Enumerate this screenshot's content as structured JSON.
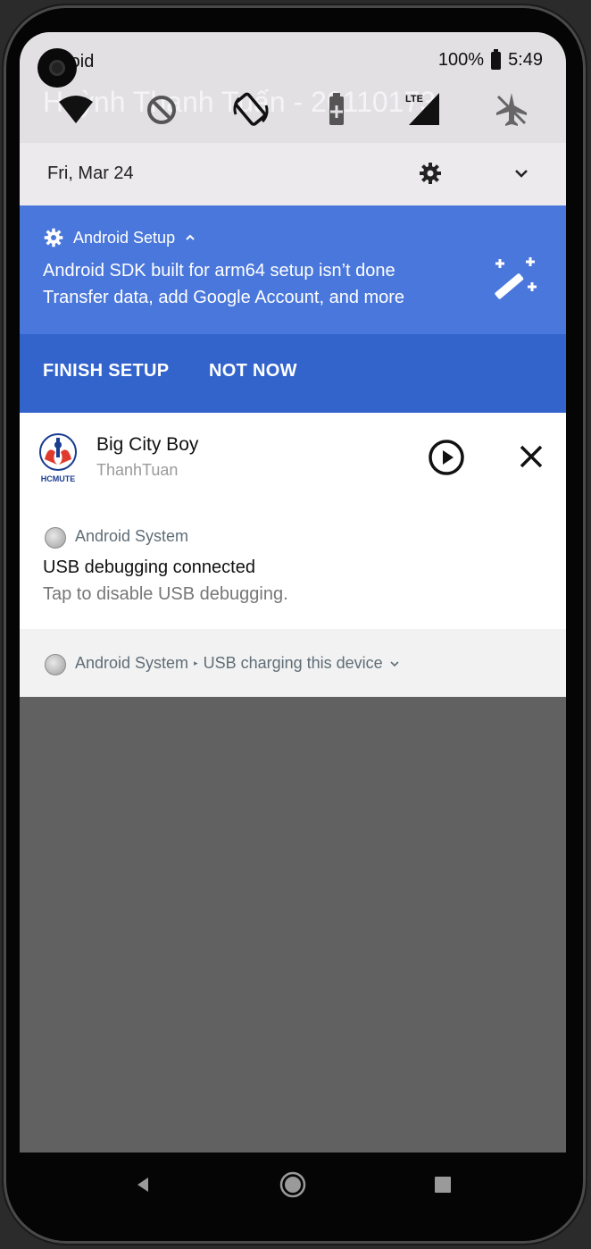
{
  "status_bar": {
    "carrier": "roid",
    "battery": "100%",
    "time": "5:49"
  },
  "shade": {
    "ghost_title": "Huỳnh Thanh Tuấn - 20110173",
    "date": "Fri, Mar 24"
  },
  "setup_notification": {
    "app": "Android Setup",
    "line1": "Android SDK built for arm64 setup isn’t done",
    "line2": "Transfer data, add Google Account, and more",
    "action_finish": "FINISH SETUP",
    "action_not_now": "NOT NOW",
    "accent_color": "#4a77db"
  },
  "media_notification": {
    "title": "Big City Boy",
    "artist": "ThanhTuan",
    "logo_text": "HCMUTE"
  },
  "usb_notification": {
    "app": "Android System",
    "title": "USB debugging connected",
    "text": "Tap to disable USB debugging."
  },
  "charging_notification": {
    "app": "Android System",
    "text": "USB charging this device"
  },
  "icons": {
    "qs": [
      "wifi-icon",
      "do-not-disturb-icon",
      "auto-rotate-icon",
      "battery-saver-icon",
      "mobile-data-icon",
      "airplane-mode-icon"
    ],
    "nav": [
      "back-icon",
      "home-icon",
      "recents-icon"
    ]
  }
}
